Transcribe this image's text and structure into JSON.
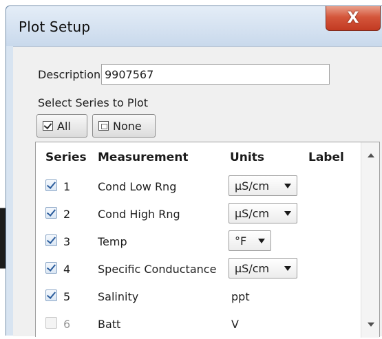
{
  "window": {
    "title": "Plot Setup",
    "close_label": "X"
  },
  "description": {
    "label": "Description:",
    "value": "9907567"
  },
  "series_select": {
    "label": "Select Series to Plot",
    "all_label": "All",
    "none_label": "None"
  },
  "table": {
    "headers": {
      "series": "Series",
      "measurement": "Measurement",
      "units": "Units",
      "label": "Label"
    },
    "rows": [
      {
        "series": "1",
        "measurement": "Cond Low Rng",
        "units": "µS/cm",
        "checked": true,
        "units_dropdown": true
      },
      {
        "series": "2",
        "measurement": "Cond High Rng",
        "units": "µS/cm",
        "checked": true,
        "units_dropdown": true
      },
      {
        "series": "3",
        "measurement": "Temp",
        "units": "°F",
        "checked": true,
        "units_dropdown": true
      },
      {
        "series": "4",
        "measurement": "Specific Conductance",
        "units": "µS/cm",
        "checked": true,
        "units_dropdown": true
      },
      {
        "series": "5",
        "measurement": "Salinity",
        "units": "ppt",
        "checked": true,
        "units_dropdown": false
      },
      {
        "series": "6",
        "measurement": "Batt",
        "units": "V",
        "checked": false,
        "disabled": true,
        "units_dropdown": false
      }
    ]
  },
  "icons": {
    "close": "close-icon",
    "all": "checkbox-checked-icon",
    "none": "checkbox-empty-icon",
    "dropdown": "chevron-down-icon",
    "scroll_up": "scroll-up-arrow-icon",
    "scroll_down": "scroll-down-arrow-icon"
  },
  "colors": {
    "titlebar": "#d8e4f1",
    "close_button": "#c8452b",
    "checkbox_check": "#2a5c9c"
  }
}
